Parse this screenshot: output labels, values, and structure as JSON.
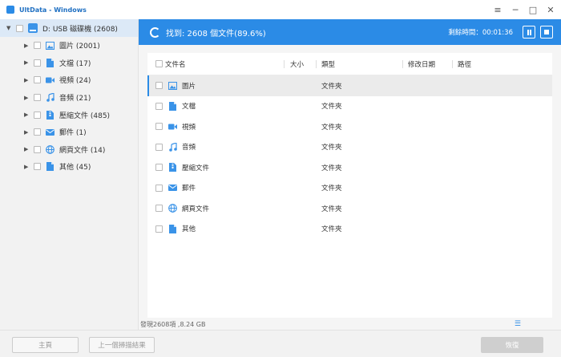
{
  "window": {
    "title": "UltData - Windows",
    "controls": {
      "menu": "≡",
      "minimize": "─",
      "maximize": "□",
      "close": "✕"
    }
  },
  "sidebar": {
    "root": {
      "label": "D: USB 磁碟機 (2608)"
    },
    "items": [
      {
        "label": "圖片 (2001)",
        "icon": "image-icon",
        "color": "#3a93e8"
      },
      {
        "label": "文檔 (17)",
        "icon": "document-icon",
        "color": "#3a93e8"
      },
      {
        "label": "視頻 (24)",
        "icon": "video-icon",
        "color": "#3a93e8"
      },
      {
        "label": "音頻 (21)",
        "icon": "music-icon",
        "color": "#3a93e8"
      },
      {
        "label": "壓縮文件 (485)",
        "icon": "archive-icon",
        "color": "#3a93e8"
      },
      {
        "label": "郵件 (1)",
        "icon": "mail-icon",
        "color": "#3a93e8"
      },
      {
        "label": "網頁文件 (14)",
        "icon": "web-icon",
        "color": "#3a93e8"
      },
      {
        "label": "其他 (45)",
        "icon": "other-file-icon",
        "color": "#3a93e8"
      }
    ]
  },
  "scan": {
    "found_text": "找到: 2608 個文件(89.6%)",
    "remaining_text": "剩餘時間：00:01:36",
    "progress_percent": 89.6,
    "accent": "#2b8be6"
  },
  "table": {
    "headers": {
      "name": "文件名",
      "size": "大小",
      "type": "類型",
      "date": "修改日期",
      "path": "路徑"
    },
    "rows": [
      {
        "name": "圖片",
        "type": "文件夾",
        "icon": "image-icon"
      },
      {
        "name": "文檔",
        "type": "文件夾",
        "icon": "document-icon"
      },
      {
        "name": "視頻",
        "type": "文件夾",
        "icon": "video-icon"
      },
      {
        "name": "音頻",
        "type": "文件夾",
        "icon": "music-icon"
      },
      {
        "name": "壓縮文件",
        "type": "文件夾",
        "icon": "archive-icon"
      },
      {
        "name": "郵件",
        "type": "文件夾",
        "icon": "mail-icon"
      },
      {
        "name": "網頁文件",
        "type": "文件夾",
        "icon": "web-icon"
      },
      {
        "name": "其他",
        "type": "文件夾",
        "icon": "other-file-icon"
      }
    ]
  },
  "status": {
    "text": "發現2608項 ,8.24 GB"
  },
  "footer": {
    "home_label": "主頁",
    "prev_label": "上一個掃描結果",
    "recover_label": "恢復"
  }
}
